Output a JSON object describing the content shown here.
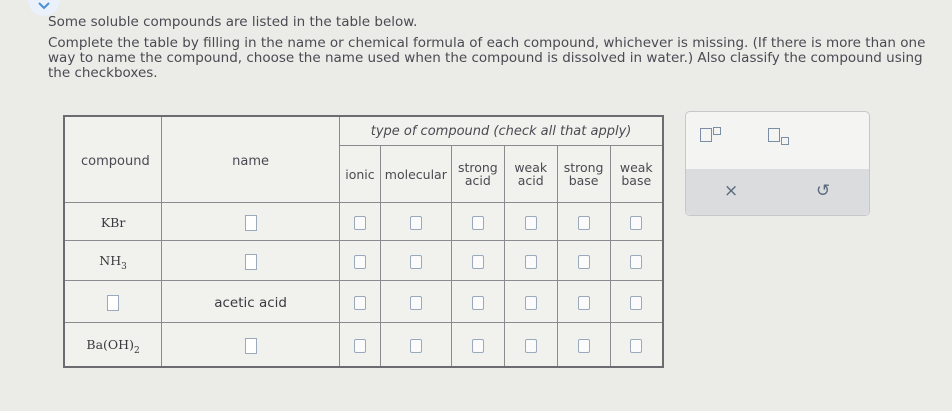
{
  "intro": "Some soluble compounds are listed in the table below.",
  "instructions": "Complete the table by filling in the name or chemical formula of each compound, whichever is missing. (If there is more than one way to name the compound, choose the name used when the compound is dissolved in water.) Also classify the compound using the checkboxes.",
  "table": {
    "compound_header": "compound",
    "name_header": "name",
    "type_header": "type of compound (check all that apply)",
    "subheaders": [
      {
        "line1": "ionic",
        "line2": ""
      },
      {
        "line1": "molecular",
        "line2": ""
      },
      {
        "line1": "strong",
        "line2": "acid"
      },
      {
        "line1": "weak",
        "line2": "acid"
      },
      {
        "line1": "strong",
        "line2": "base"
      },
      {
        "line1": "weak",
        "line2": "base"
      }
    ],
    "rows": [
      {
        "formula": "KBr",
        "formula_sub": "",
        "formula_rest": "",
        "name": ""
      },
      {
        "formula": "NH",
        "formula_sub": "3",
        "formula_rest": "",
        "name": ""
      },
      {
        "formula": "",
        "formula_sub": "",
        "formula_rest": "",
        "name": "acetic acid"
      },
      {
        "formula": "Ba(OH)",
        "formula_sub": "2",
        "formula_rest": "",
        "name": ""
      }
    ]
  },
  "panel": {
    "superscript_icon": "superscript-icon",
    "subscript_icon": "subscript-icon",
    "clear_label": "×",
    "reset_label": "↺"
  },
  "colors": {
    "accent": "#4a8fd8",
    "checkbox_border": "#9aa9bb"
  }
}
